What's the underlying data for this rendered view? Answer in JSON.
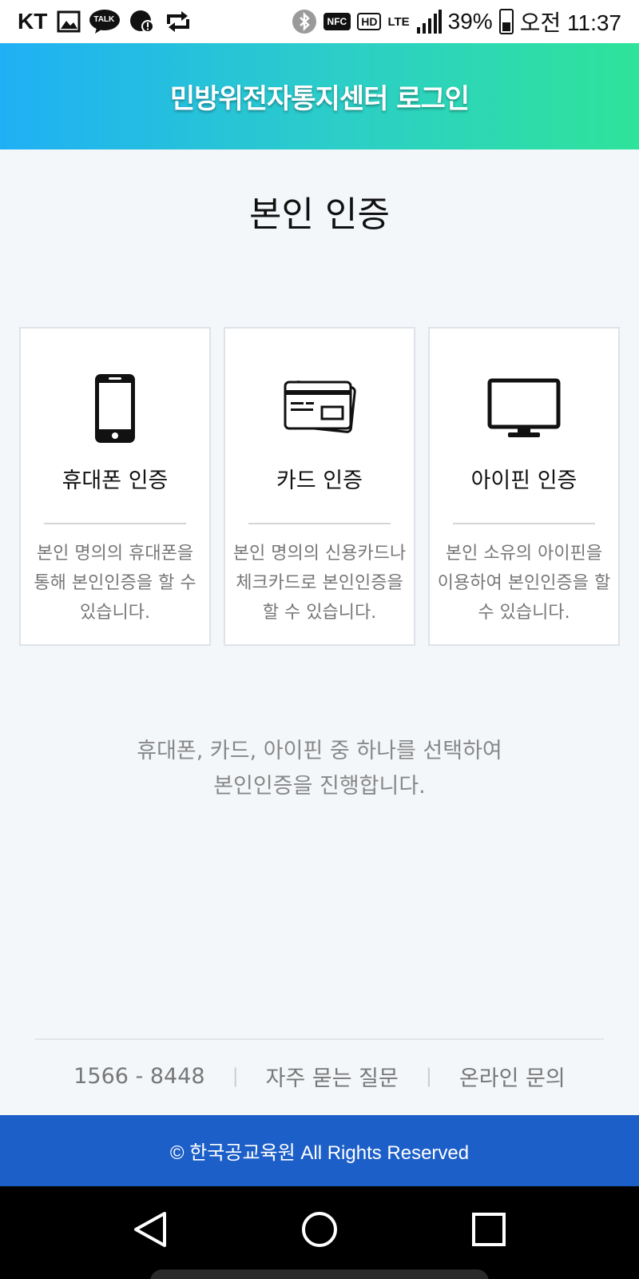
{
  "status_bar": {
    "carrier": "KT",
    "talk_icon_text": "TALK",
    "nfc_text": "NFC",
    "hd_text": "HD",
    "lte_text": "LTE",
    "battery": "39%",
    "time": "오전 11:37"
  },
  "header": {
    "title": "민방위전자통지센터 로그인"
  },
  "page": {
    "title": "본인 인증"
  },
  "cards": [
    {
      "icon": "smartphone-icon",
      "title": "휴대폰 인증",
      "desc": "본인 명의의 휴대폰을 통해 본인인증을 할 수 있습니다."
    },
    {
      "icon": "credit-card-icon",
      "title": "카드 인증",
      "desc": "본인 명의의 신용카드나 체크카드로 본인인증을 할 수 있습니다."
    },
    {
      "icon": "monitor-icon",
      "title": "아이핀 인증",
      "desc": "본인 소유의 아이핀을 이용하여 본인인증을 할 수 있습니다."
    }
  ],
  "notice": {
    "line1": "휴대폰, 카드, 아이핀 중 하나를 선택하여",
    "line2": "본인인증을 진행합니다."
  },
  "footer": {
    "phone": "1566 - 8448",
    "separator": "|",
    "faq": "자주 묻는 질문",
    "inquiry": "온라인 문의",
    "copyright": "© 한국공교육원 All Rights Reserved"
  },
  "nav": {
    "back": "back-icon",
    "home": "home-icon",
    "recents": "recents-icon"
  },
  "colors": {
    "header_start": "#1fb0f5",
    "header_end": "#2ee39a",
    "footer_bg": "#1d5fc8"
  }
}
